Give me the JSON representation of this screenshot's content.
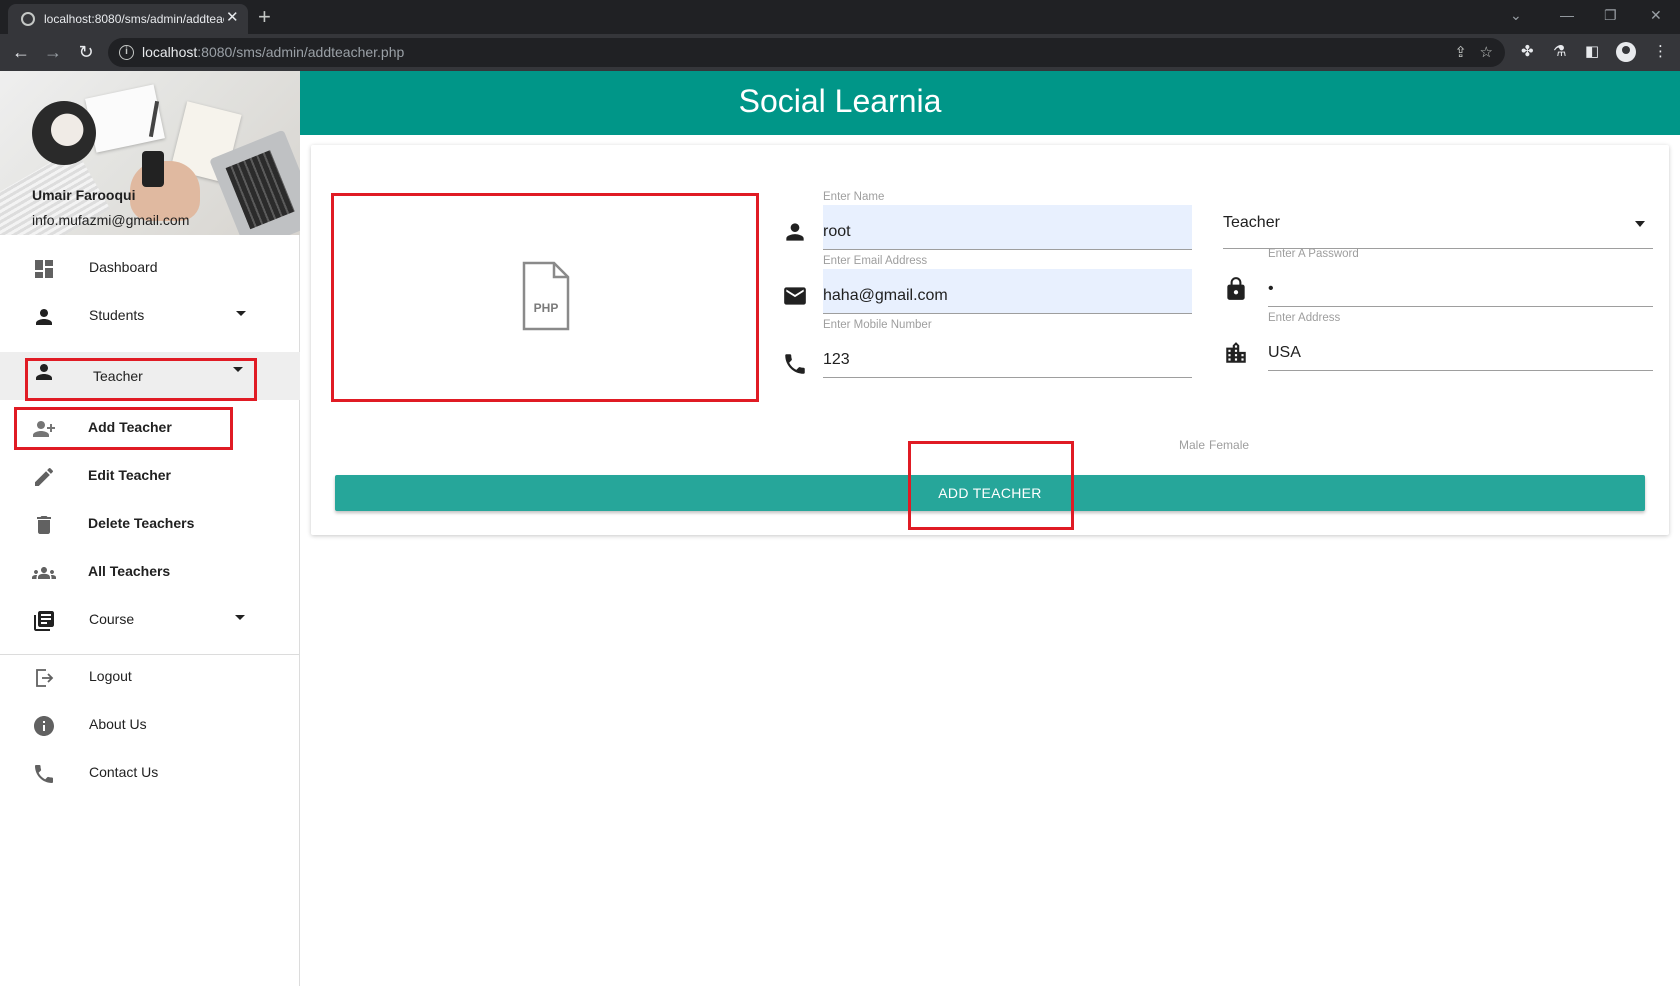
{
  "browser": {
    "tab_title": "localhost:8080/sms/admin/addteacher.php",
    "url_host": "localhost",
    "url_rest": ":8080/sms/admin/addteacher.php"
  },
  "app": {
    "brand": "Social Learnia",
    "accent_color": "#009688",
    "button_color": "#26a69a",
    "highlight_color": "#e01b24"
  },
  "user": {
    "name": "Umair Farooqui",
    "email": "info.mufazmi@gmail.com"
  },
  "sidebar": {
    "items": [
      {
        "label": "Dashboard",
        "icon": "dashboard-icon"
      },
      {
        "label": "Students",
        "icon": "person-icon",
        "dropdown": true
      },
      {
        "label": "Teacher",
        "icon": "person-icon",
        "dropdown": true,
        "active": true
      },
      {
        "label": "Add Teacher",
        "icon": "person-add-icon"
      },
      {
        "label": "Edit Teacher",
        "icon": "pencil-icon"
      },
      {
        "label": "Delete Teachers",
        "icon": "trash-icon"
      },
      {
        "label": "All Teachers",
        "icon": "group-icon"
      },
      {
        "label": "Course",
        "icon": "library-books-icon",
        "dropdown": true
      },
      {
        "label": "Logout",
        "icon": "logout-icon"
      },
      {
        "label": "About Us",
        "icon": "info-icon"
      },
      {
        "label": "Contact Us",
        "icon": "phone-icon"
      }
    ]
  },
  "form": {
    "file_type_label": "PHP",
    "name": {
      "label": "Enter Name",
      "value": "root"
    },
    "email": {
      "label": "Enter Email Address",
      "value": "haha@gmail.com"
    },
    "mobile": {
      "label": "Enter Mobile Number",
      "value": "123"
    },
    "role": {
      "value": "Teacher"
    },
    "password": {
      "label": "Enter A Password",
      "value": "•"
    },
    "address": {
      "label": "Enter Address",
      "value": "USA"
    },
    "gender": {
      "options": [
        "Male",
        "Female"
      ]
    },
    "submit_label": "ADD TEACHER"
  }
}
